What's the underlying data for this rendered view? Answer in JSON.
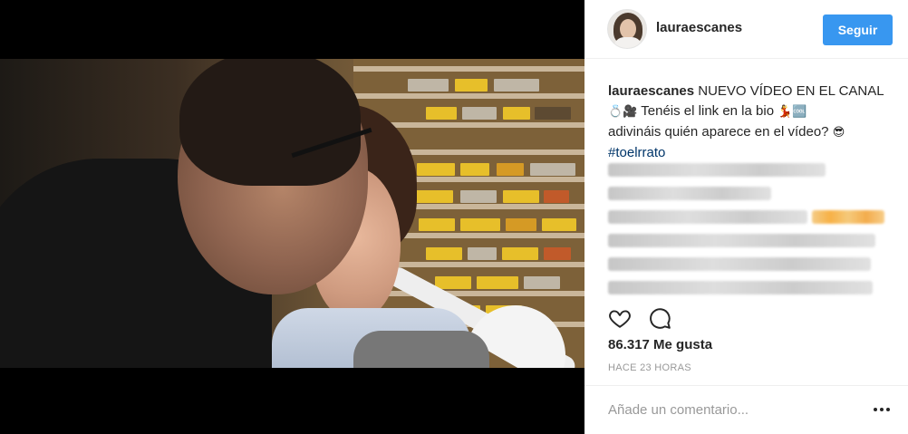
{
  "post": {
    "username": "lauraescanes",
    "follow_label": "Seguir",
    "caption": {
      "user": "lauraescanes",
      "line1": "NUEVO VÍDEO EN EL CANAL",
      "line2_text": "Tenéis el link en la bio",
      "line3_text": "adivináis quién aparece en el vídeo?",
      "hashtag": "#toelrrato",
      "emoji_ring": "💍",
      "emoji_camera": "🎥",
      "emoji_dancer": "💃",
      "emoji_subtitles": "🆒",
      "emoji_sunglasses": "😎"
    },
    "likes_text": "86.317 Me gusta",
    "timestamp": "Hace 23 horas",
    "comment_placeholder": "Añade un comentario...",
    "blurred_comments_count": 6
  },
  "icons": {
    "like": "heart-icon",
    "comment": "comment-icon",
    "more": "more-options-icon"
  },
  "colors": {
    "follow_button": "#3897f0",
    "hashtag": "#003569",
    "secondary_text": "#999999"
  }
}
